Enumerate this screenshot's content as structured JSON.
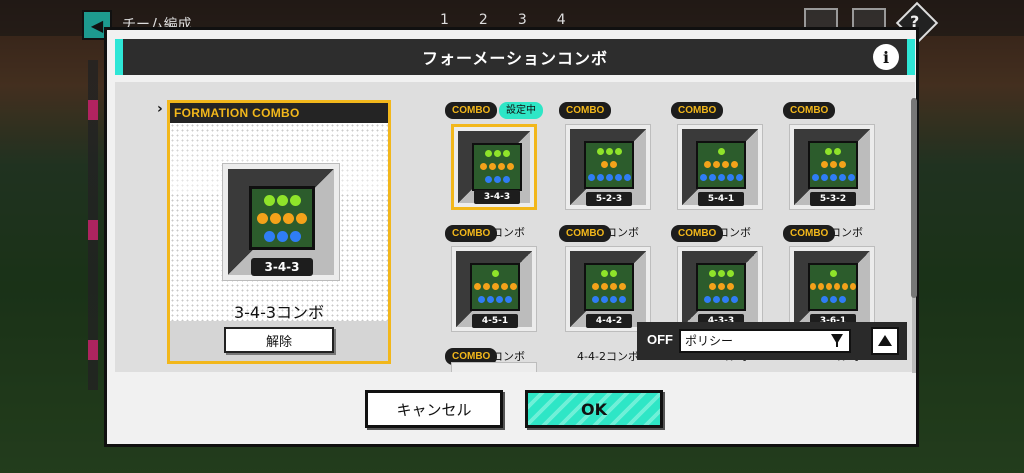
{
  "background": {
    "title": "チーム編成",
    "pages": [
      "1",
      "2",
      "3",
      "4"
    ]
  },
  "modal": {
    "title": "フォーメーションコンボ",
    "info_icon": "info-icon",
    "selected": {
      "header": "FORMATION COMBO",
      "formation": "3-4-3",
      "name": "3-4-3コンボ",
      "release_label": "解除"
    },
    "combo_tag": "COMBO",
    "set_tag": "設定中",
    "combos": [
      {
        "formation": "3-4-3",
        "name": "3-4-3コンボ",
        "selected": true
      },
      {
        "formation": "5-2-3",
        "name": "5-2-3コンボ",
        "selected": false
      },
      {
        "formation": "5-4-1",
        "name": "5-4-1コンボ",
        "selected": false
      },
      {
        "formation": "5-3-2",
        "name": "5-3-2コンボ",
        "selected": false
      },
      {
        "formation": "4-5-1",
        "name": "4-5-1コンボ",
        "selected": false
      },
      {
        "formation": "4-4-2",
        "name": "4-4-2コンボ",
        "selected": false
      },
      {
        "formation": "4-3-3",
        "name": "4-3-3コンボ",
        "selected": false
      },
      {
        "formation": "3-6-1",
        "name": "3-6-1コンボ",
        "selected": false
      }
    ],
    "filter": {
      "toggle_label": "OFF",
      "select_value": "ポリシー"
    },
    "cancel_label": "キャンセル",
    "ok_label": "OK"
  }
}
